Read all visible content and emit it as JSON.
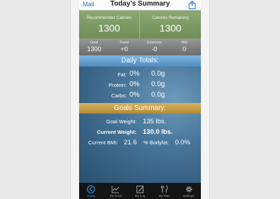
{
  "header": {
    "back_label": "Mail",
    "title": "Today's Summary"
  },
  "calories": {
    "recommended_label": "Recommended Calories",
    "recommended_value": "1300",
    "remaining_label": "Calories Remaining",
    "remaining_value": "1300"
  },
  "stats": [
    {
      "label": "Goal",
      "value": "1300"
    },
    {
      "label": "Food",
      "value": "+0"
    },
    {
      "label": "Exercise",
      "value": "-0"
    },
    {
      "label": "Net",
      "value": "0"
    }
  ],
  "daily_totals": {
    "title": "Daily Totals:",
    "rows": [
      {
        "name": "Fat:",
        "percent": "0%",
        "grams": "0.0g"
      },
      {
        "name": "Protein:",
        "percent": "0%",
        "grams": "0.0g"
      },
      {
        "name": "Carbs:",
        "percent": "0%",
        "grams": "0.0g"
      }
    ]
  },
  "goals_summary": {
    "title": "Goals Summary:",
    "goal_weight_label": "Goal Weight:",
    "goal_weight_value": "135 lbs.",
    "current_weight_label": "Current Weight:",
    "current_weight_value": "130.0 lbs.",
    "bmi_label": "Current BMI:",
    "bmi_value": "21.6",
    "bodyfat_label": "% Bodyfat:",
    "bodyfat_value": "0.0%"
  },
  "tabs": [
    {
      "label": "Today",
      "icon": "clock-icon",
      "active": true
    },
    {
      "label": "My Goal",
      "icon": "chart-icon",
      "active": false
    },
    {
      "label": "My Log",
      "icon": "notebook-icon",
      "active": false
    },
    {
      "label": "My Plan",
      "icon": "utensils-icon",
      "active": false
    },
    {
      "label": "Settings",
      "icon": "gear-icon",
      "active": false
    }
  ],
  "colors": {
    "accent": "#2673d6",
    "tab_active": "#2f8fe6",
    "calorie_panel": "#7d9a66",
    "daily_band": "#5f9acb",
    "goals_band": "#c7a14a"
  }
}
